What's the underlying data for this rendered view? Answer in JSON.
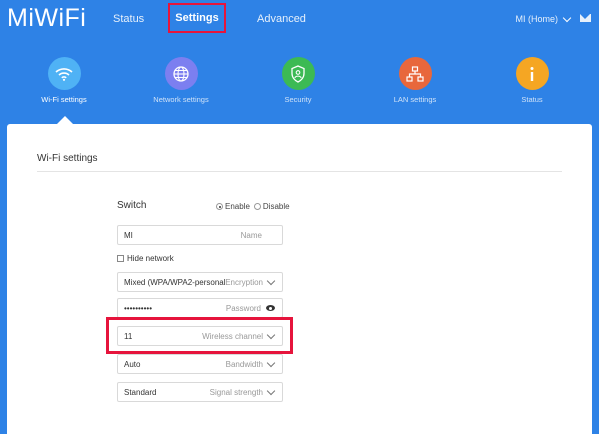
{
  "header": {
    "logo": "MiWiFi",
    "nav": {
      "status": "Status",
      "settings": "Settings",
      "advanced": "Advanced"
    },
    "account": "MI (Home)",
    "mail_icon": "mail-icon"
  },
  "categories": [
    {
      "label": "Wi-Fi settings",
      "icon": "wifi-icon",
      "color": "#4fb2f5"
    },
    {
      "label": "Network settings",
      "icon": "globe-icon",
      "color": "#7c7ff0"
    },
    {
      "label": "Security",
      "icon": "shield-icon",
      "color": "#3cba54"
    },
    {
      "label": "LAN settings",
      "icon": "network-icon",
      "color": "#e8673c"
    },
    {
      "label": "Status",
      "icon": "info-icon",
      "color": "#f5a623"
    }
  ],
  "main": {
    "title": "Wi-Fi settings",
    "switch": {
      "label": "Switch",
      "enable": "Enable",
      "disable": "Disable",
      "selected": "Enable"
    },
    "name": {
      "value": "MI",
      "hint": "Name"
    },
    "hide_network": "Hide network",
    "encryption": {
      "value": "Mixed (WPA/WPA2-personal)",
      "hint": "Encryption"
    },
    "password": {
      "value": "••••••••••",
      "hint": "Password"
    },
    "channel": {
      "value": "11",
      "hint": "Wireless channel"
    },
    "bandwidth": {
      "value": "Auto",
      "hint": "Bandwidth"
    },
    "signal": {
      "value": "Standard",
      "hint": "Signal strength"
    }
  },
  "colors": {
    "header_bg": "#2e82e6",
    "highlight": "#e6143c"
  }
}
